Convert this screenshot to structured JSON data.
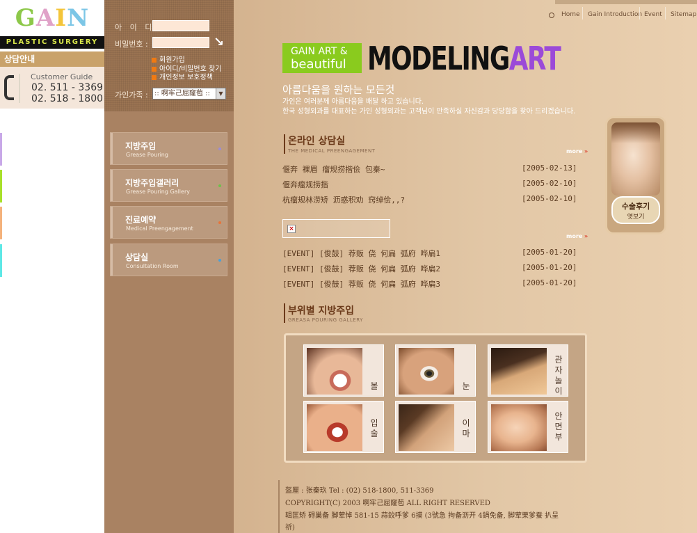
{
  "logo": {
    "text": "GAIN",
    "subtitle": "PLASTIC SURGERY",
    "letter_colors": [
      "#8dc84a",
      "#e0a2c8",
      "#f4c53a",
      "#7cc6e6"
    ]
  },
  "consult_bar": {
    "label": "상담안내"
  },
  "customer_guide": {
    "title": "Customer Guide",
    "phone1": "02. 511 - 3369",
    "phone2": "02. 518 - 1800"
  },
  "left_strips": [
    "#c8a8e8",
    "#a8e02a",
    "#f4b27c",
    "#5ee8e6"
  ],
  "login": {
    "id_label": "아 이 디 :",
    "id_value": "",
    "pw_label": "비밀번호 :",
    "pw_value": "",
    "links": [
      "회원가입",
      "아이디/비밀번호 찾기",
      "개인정보 보호정책"
    ],
    "family_label": "가인가족 :",
    "family_value": ":: 啊牢己屈窿苞 ::"
  },
  "menu": [
    {
      "ko": "지방주입",
      "en": "Grease Pouring",
      "dot": "#9b8cd8"
    },
    {
      "ko": "지방주입갤러리",
      "en": "Grease Pouring Gallery",
      "dot": "#6ec04a"
    },
    {
      "ko": "진료예약",
      "en": "Medical Preengagement",
      "dot": "#e8743a"
    },
    {
      "ko": "상담실",
      "en": "Consultation Room",
      "dot": "#4aa0d8"
    }
  ],
  "topnav": [
    "Home",
    "Gain Introduction",
    "Event",
    "Sitemap"
  ],
  "brand": {
    "green_line1": "GAIN ART &",
    "green_line2": "beautiful",
    "big_part1": "MODELING",
    "big_part2": "ART"
  },
  "slogan": {
    "title": "아름다움을 원하는 모든것",
    "line1": "가인은 여러분께 아름다움을 배달 하고 있습니다.",
    "line2": "한국 성형외과를 대표하는 가인 성형외과는 고객님이 만족하실 자신감과 당당함을 찾아 드리겠습니다."
  },
  "online": {
    "title": "온라인 상담실",
    "sub": "THE MEDICAL PREENGAGEMENT",
    "more": "more",
    "rows": [
      {
        "title": "偃奔 裸眉 瘤规捞揩侩 包秦~",
        "date": "[2005-02-13]"
      },
      {
        "title": "偃奔瘤规捞揩",
        "date": "[2005-02-10]"
      },
      {
        "title": "杭瘤规林涝矫 沥惑积劝 窍绰侩,,?",
        "date": "[2005-02-10]"
      }
    ]
  },
  "event": {
    "more": "more",
    "rows": [
      {
        "title": "[EVENT] [俊鼓] 荐贩 侥 何扁 弧府 哗扁1",
        "date": "[2005-01-20]"
      },
      {
        "title": "[EVENT] [俊鼓] 荐贩 侥 何扁 弧府 哗扁2",
        "date": "[2005-01-20]"
      },
      {
        "title": "[EVENT] [俊鼓] 荐贩 侥 何扁 弧府 哗扁3",
        "date": "[2005-01-20]"
      }
    ]
  },
  "gallery": {
    "title": "부위별 지방주입",
    "sub": "GREASA POURING GALLERY",
    "items": [
      {
        "label": "볼"
      },
      {
        "label": "눈"
      },
      {
        "label": "관자놀이"
      },
      {
        "label": "입술"
      },
      {
        "label": "이마"
      },
      {
        "label": "안면부"
      }
    ]
  },
  "side_promo": {
    "line1": "수술후기",
    "line2": "엿보기"
  },
  "footer": {
    "line1": "盔厘 : 张秦玖 Tel : (02) 518-1800, 511-3369",
    "line2": "COPYRIGHT(C) 2003 啊牢己屈窿苞 ALL RIGHT RESERVED",
    "line3": "辑匡矫 碍巢备 脚荤悼 581-15 蒜鉸呼爹 6摸 (3號急 拘备沥开 4鍋免备, 脚荤栗爹蚕 扒呈",
    "line4": "祈)"
  }
}
